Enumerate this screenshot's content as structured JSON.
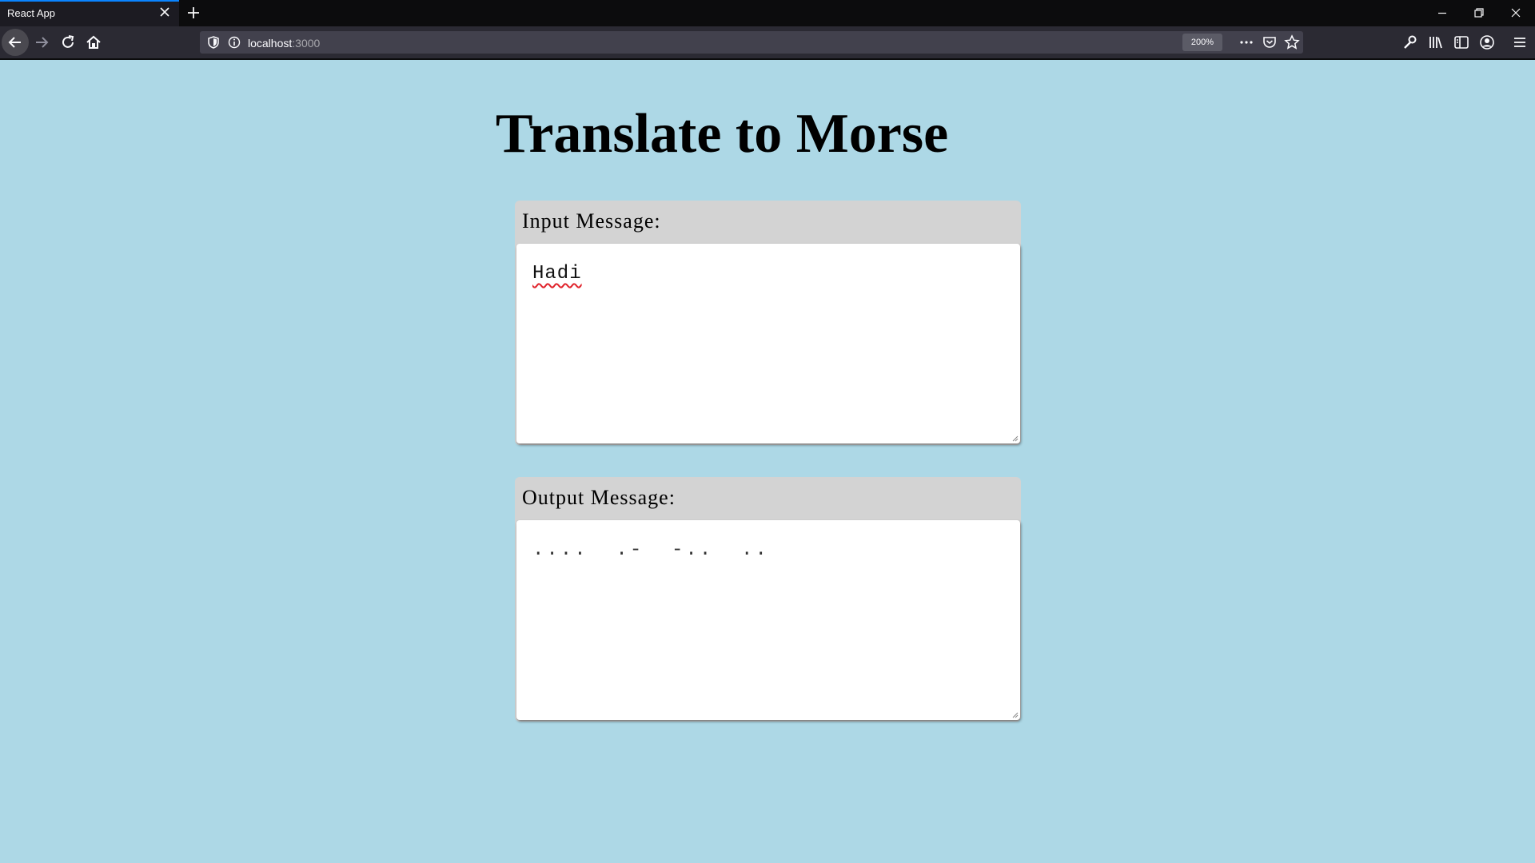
{
  "browser": {
    "tab_title": "React App",
    "url_host": "localhost",
    "url_port": ":3000",
    "zoom": "200%",
    "accent_color": "#0a84ff"
  },
  "page": {
    "title": "Translate to Morse",
    "background_color": "#add8e6",
    "input": {
      "label": "Input Message:",
      "value": "Hadi"
    },
    "output": {
      "label": "Output Message:",
      "value": "....  .-  -..  .."
    }
  },
  "icons": {
    "tab": [
      "close-icon",
      "plus-icon"
    ],
    "window": [
      "minimize-icon",
      "restore-icon",
      "close-icon"
    ],
    "nav": [
      "back-arrow-icon",
      "forward-arrow-icon",
      "reload-icon",
      "home-icon"
    ],
    "url": [
      "shield-icon",
      "info-icon",
      "more-icon",
      "pocket-icon",
      "star-icon"
    ],
    "toolbar_right": [
      "wrench-icon",
      "library-icon",
      "sidebar-icon",
      "account-icon",
      "menu-icon"
    ]
  }
}
